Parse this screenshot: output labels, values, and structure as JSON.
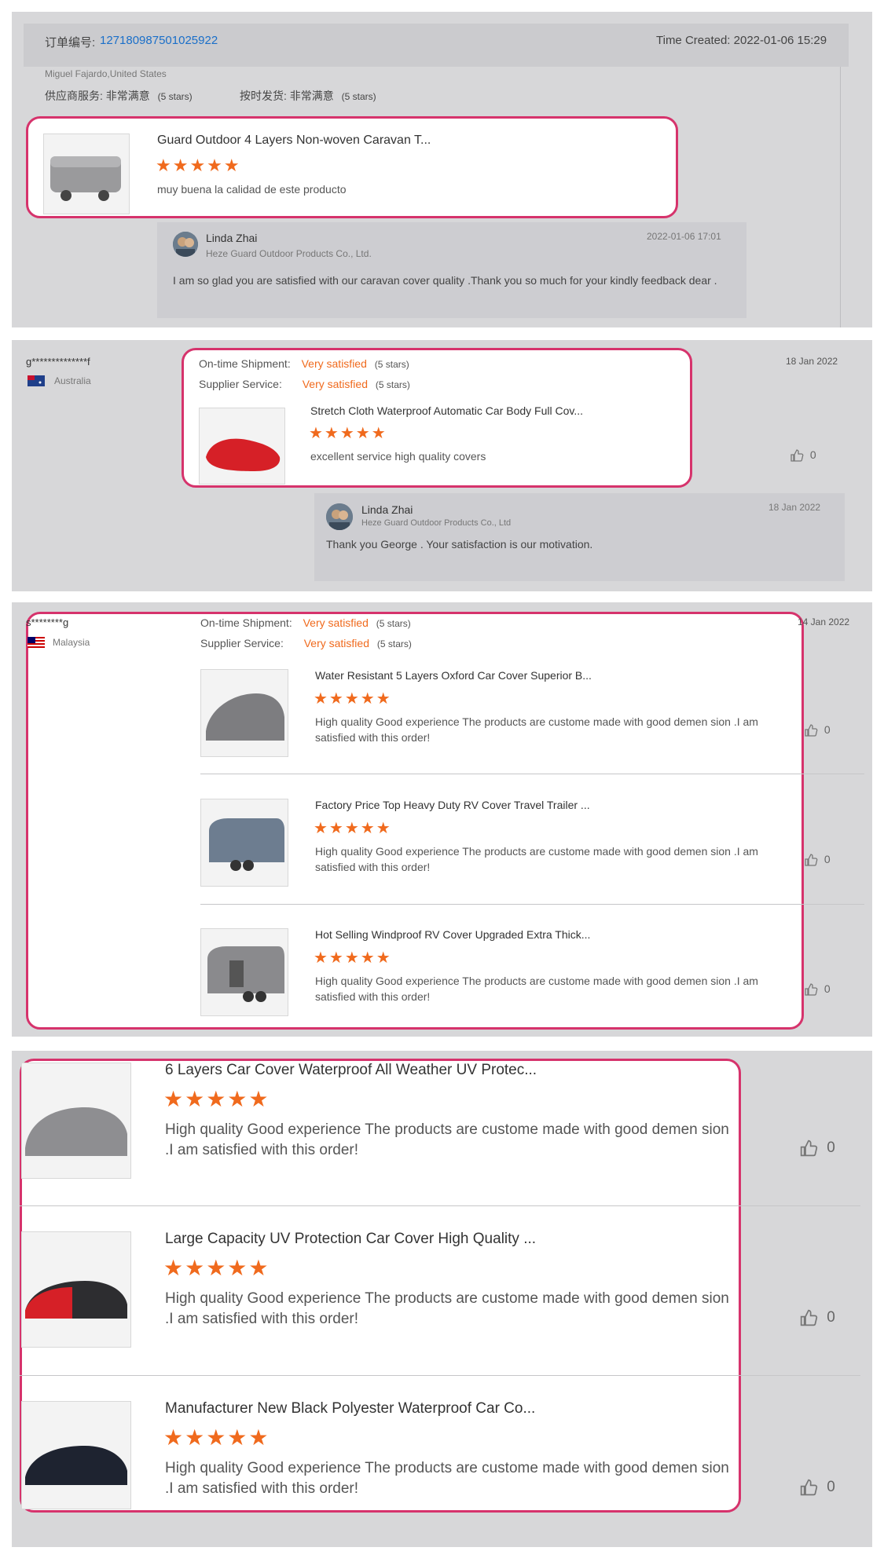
{
  "panel1": {
    "order_label": "订单编号:",
    "order_number": "127180987501025922",
    "time_created": "Time Created: 2022-01-06 15:29",
    "buyer": "Miguel Fajardo,United States",
    "supplier_service_label": "供应商服务:",
    "supplier_service_value": "非常满意",
    "supplier_service_stars": "(5 stars)",
    "shipment_label": "按时发货:",
    "shipment_value": "非常满意",
    "shipment_stars": "(5 stars)",
    "product_title": "Guard Outdoor 4 Layers Non-woven Caravan T...",
    "rating": 5,
    "stars": "★★★★★",
    "comment": "muy buena la calidad de este producto",
    "reply": {
      "name": "Linda Zhai",
      "company": "Heze Guard Outdoor Products Co., Ltd.",
      "date": "2022-01-06 17:01",
      "text": "I am so glad you are satisfied with our caravan cover quality .Thank you so much for your kindly feedback dear ."
    }
  },
  "panel2": {
    "buyer": "g**************f",
    "country": "Australia",
    "date": "18 Jan 2022",
    "shipment_label": "On-time Shipment:",
    "shipment_value": "Very satisfied",
    "shipment_stars": "(5 stars)",
    "supplier_label": "Supplier Service:",
    "supplier_value": "Very satisfied",
    "supplier_stars": "(5 stars)",
    "product_title": "Stretch Cloth Waterproof Automatic Car Body Full Cov...",
    "rating": 5,
    "stars": "★★★★★",
    "comment": "excellent service high quality covers",
    "likes": "0",
    "reply": {
      "name": "Linda Zhai",
      "company": "Heze Guard Outdoor Products Co., Ltd",
      "date": "18 Jan 2022",
      "text": "Thank you George . Your satisfaction is our motivation."
    }
  },
  "panel3": {
    "buyer": "s********g",
    "country": "Malaysia",
    "date": "14 Jan 2022",
    "shipment_label": "On-time Shipment:",
    "shipment_value": "Very satisfied",
    "shipment_stars": "(5 stars)",
    "supplier_label": "Supplier Service:",
    "supplier_value": "Very satisfied",
    "supplier_stars": "(5 stars)",
    "items": [
      {
        "title": "Water Resistant 5 Layers Oxford Car Cover Superior B...",
        "stars": "★★★★★",
        "rating": 5,
        "comment": "High quality  Good experience The products  are custome made with good demen sion .I am satisfied with this order!",
        "likes": "0"
      },
      {
        "title": "Factory Price Top Heavy Duty RV Cover Travel Trailer ...",
        "stars": "★★★★★",
        "rating": 5,
        "comment": "High quality  Good experience The products  are custome made with good demen sion .I am satisfied with this order!",
        "likes": "0"
      },
      {
        "title": "Hot Selling Windproof RV Cover Upgraded Extra Thick...",
        "stars": "★★★★★",
        "rating": 5,
        "comment": "High quality  Good experience The products  are custome made with good demen sion .I am satisfied with this order!",
        "likes": "0"
      }
    ]
  },
  "panel4": {
    "items": [
      {
        "title": "6 Layers Car Cover Waterproof All Weather UV Protec...",
        "stars": "★★★★★",
        "rating": 5,
        "comment": "High quality  Good experience The products  are custome made with good demen sion .I am satisfied with this order!",
        "likes": "0"
      },
      {
        "title": "Large Capacity UV Protection Car Cover High Quality ...",
        "stars": "★★★★★",
        "rating": 5,
        "comment": "High quality  Good experience The products  are custome made with good demen sion .I am satisfied with this order!",
        "likes": "0"
      },
      {
        "title": "Manufacturer New Black Polyester Waterproof Car Co...",
        "stars": "★★★★★",
        "rating": 5,
        "comment": "High quality  Good experience The products  are custome made with good demen sion .I am satisfied with this order!",
        "likes": "0"
      }
    ]
  },
  "colors": {
    "accent": "#f06a1d",
    "highlight_border": "#d6336c",
    "link": "#1a6fc9",
    "panel_bg": "#d7d7d9"
  }
}
